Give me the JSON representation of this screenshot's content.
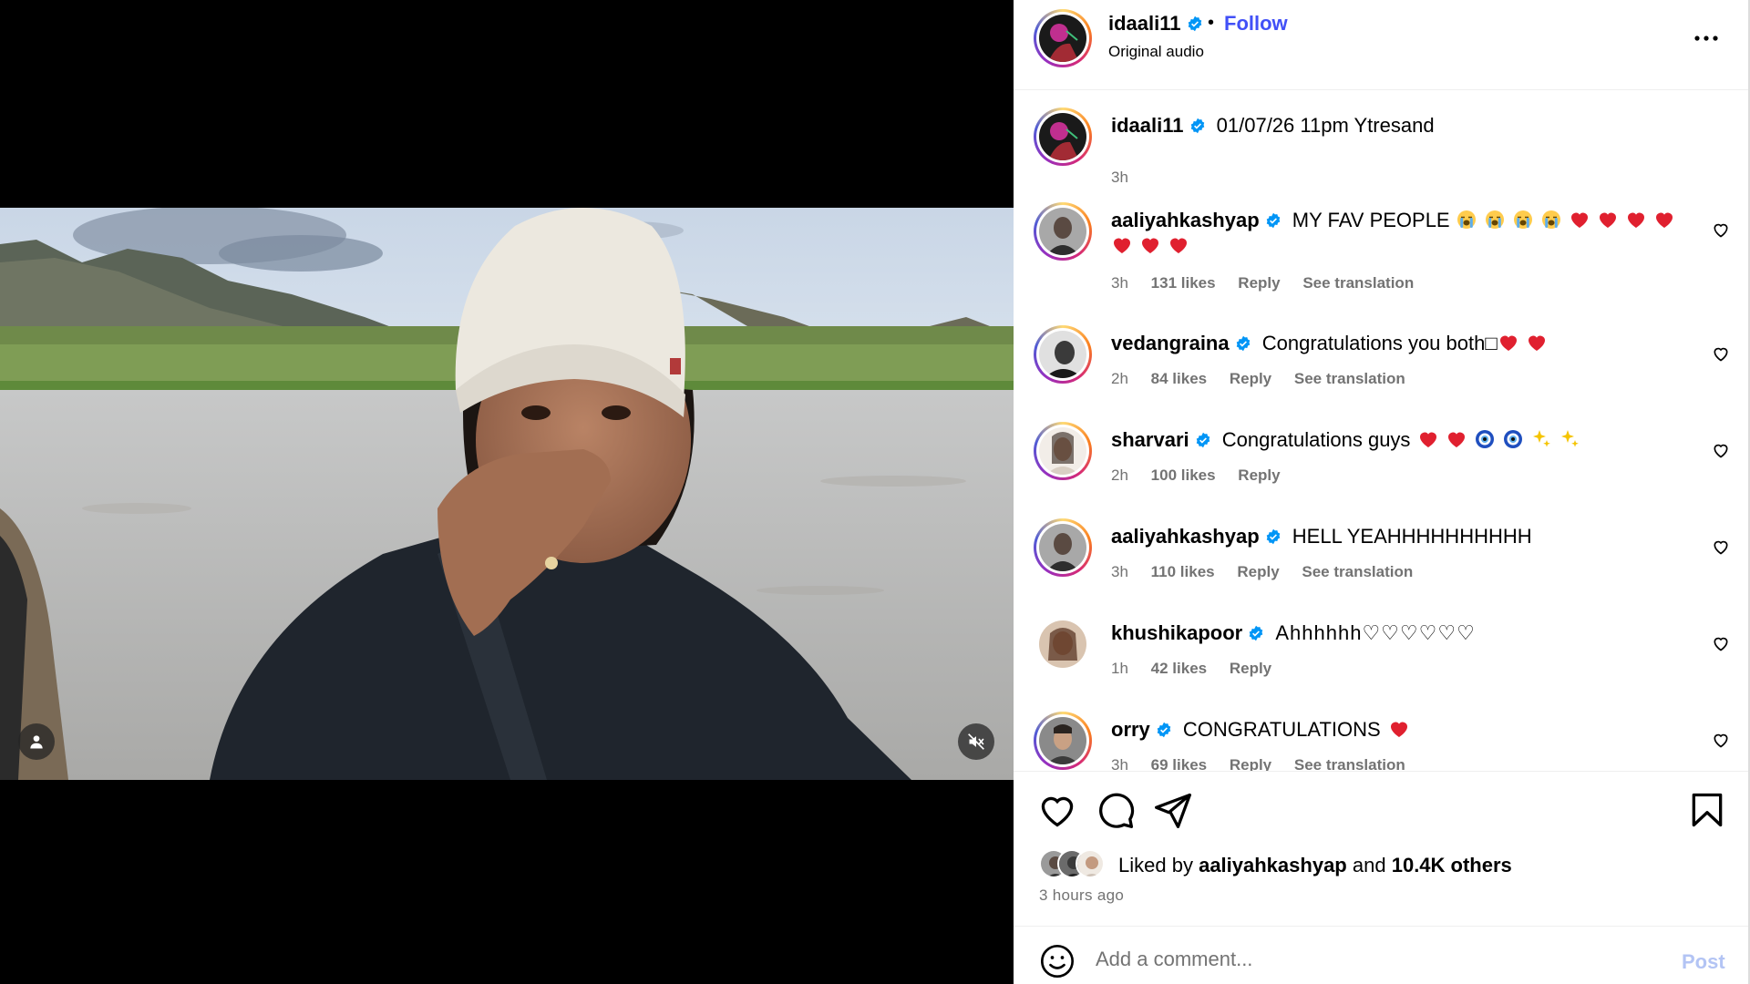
{
  "post": {
    "author": "idaali11",
    "follow_label": "Follow",
    "separator": "•",
    "audio": "Original audio"
  },
  "caption": {
    "username": "idaali11",
    "text": "01/07/26 11pm Ytresand",
    "time": "3h"
  },
  "comments": [
    {
      "username": "aaliyahkashyap",
      "text": "MY FAV PEOPLE",
      "emojis": [
        "loudly-crying-face",
        "loudly-crying-face",
        "loudly-crying-face",
        "loudly-crying-face",
        "red-heart",
        "red-heart",
        "red-heart",
        "red-heart",
        "red-heart",
        "red-heart",
        "red-heart"
      ],
      "time": "3h",
      "likes": "131 likes",
      "reply": "Reply",
      "translation": "See translation"
    },
    {
      "username": "vedangraina",
      "text": "Congratulations you both□",
      "emojis": [
        "red-heart",
        "red-heart"
      ],
      "time": "2h",
      "likes": "84 likes",
      "reply": "Reply",
      "translation": "See translation"
    },
    {
      "username": "sharvari",
      "text": "Congratulations guys",
      "emojis": [
        "red-heart",
        "red-heart",
        "nazar-amulet",
        "nazar-amulet",
        "sparkles",
        "sparkles"
      ],
      "time": "2h",
      "likes": "100 likes",
      "reply": "Reply"
    },
    {
      "username": "aaliyahkashyap",
      "text": "HELL YEAHHHHHHHHHH",
      "time": "3h",
      "likes": "110 likes",
      "reply": "Reply",
      "translation": "See translation"
    },
    {
      "username": "khushikapoor",
      "text": "Ahhhhhh♡♡♡♡♡♡",
      "time": "1h",
      "likes": "42 likes",
      "reply": "Reply"
    },
    {
      "username": "orry",
      "text": "CONGRATULATIONS",
      "emojis": [
        "red-heart"
      ],
      "time": "3h",
      "likes": "69 likes",
      "reply": "Reply",
      "translation": "See translation"
    }
  ],
  "likes": {
    "prefix": "Liked by",
    "user": "aaliyahkashyap",
    "connector": "and",
    "others": "10.4K others",
    "time_ago": "3 hours ago"
  },
  "add_comment": {
    "placeholder": "Add a comment...",
    "post_label": "Post"
  },
  "colors": {
    "verified": "#0095f6",
    "follow": "#4150f7",
    "post_disabled": "#b3c4f4",
    "muted_text": "#737373"
  },
  "icons": {
    "media": [
      "tag-user-icon",
      "mute-icon"
    ],
    "actions": [
      "heart-icon",
      "comment-icon",
      "share-icon",
      "bookmark-icon"
    ],
    "header": "more-options-icon",
    "composer": "emoji-icon"
  }
}
